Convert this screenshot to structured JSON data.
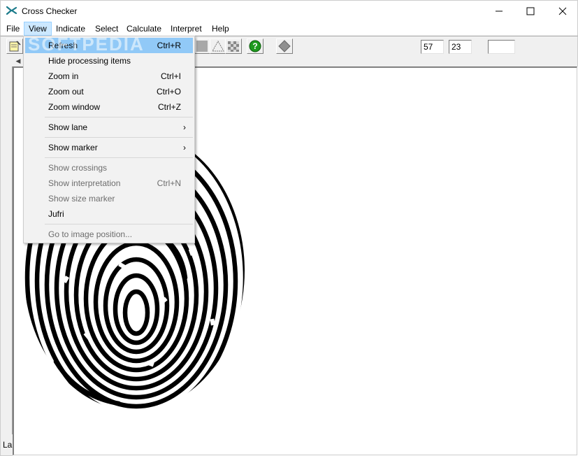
{
  "window": {
    "title": "Cross Checker",
    "controls": {
      "minimize": "—",
      "maximize": "☐",
      "close": "✕"
    }
  },
  "menubar": {
    "items": [
      "File",
      "View",
      "Indicate",
      "Select",
      "Calculate",
      "Interpret",
      "Help"
    ],
    "active": "View"
  },
  "toolbar": {
    "field1": "57",
    "field2": "23",
    "field3": ""
  },
  "view_menu": {
    "items": [
      {
        "label": "Refresh",
        "shortcut": "Ctrl+R",
        "state": "highlighted"
      },
      {
        "label": "Hide processing items",
        "shortcut": "",
        "state": "enabled"
      },
      {
        "label": "Zoom in",
        "shortcut": "Ctrl+I",
        "state": "enabled"
      },
      {
        "label": "Zoom out",
        "shortcut": "Ctrl+O",
        "state": "enabled"
      },
      {
        "label": "Zoom window",
        "shortcut": "Ctrl+Z",
        "state": "enabled"
      },
      {
        "label": "Show lane",
        "shortcut": "",
        "submenu": true,
        "state": "enabled"
      },
      {
        "label": "Show marker",
        "shortcut": "",
        "submenu": true,
        "state": "enabled"
      },
      {
        "label": "Show crossings",
        "shortcut": "",
        "state": "disabled"
      },
      {
        "label": "Show interpretation",
        "shortcut": "Ctrl+N",
        "state": "disabled"
      },
      {
        "label": "Show size marker",
        "shortcut": "",
        "state": "disabled"
      },
      {
        "label": "Jufri",
        "shortcut": "",
        "state": "enabled"
      },
      {
        "label": "Go to image position...",
        "shortcut": "",
        "state": "disabled"
      }
    ]
  },
  "watermark": "SOFTPEDIA",
  "status": {
    "left": "La"
  },
  "icons": {
    "app": "scissors-icon",
    "submenu_arrow": "›"
  },
  "colors": {
    "menu_highlight": "#91c9f7",
    "menubar_active": "#cce8ff",
    "help_icon_green": "#1e9a1e"
  }
}
